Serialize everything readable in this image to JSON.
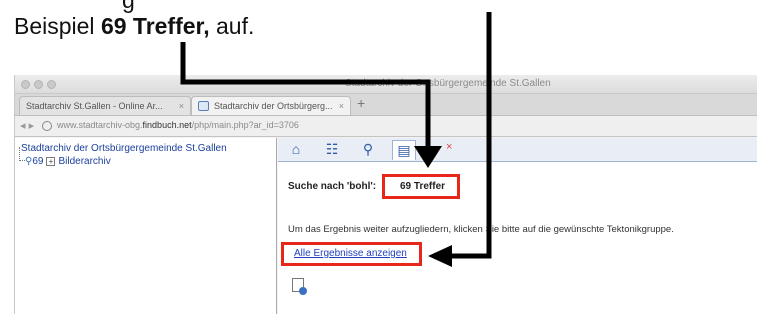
{
  "caption": {
    "line1_end": "g",
    "line2_prefix": "Beispiel ",
    "line2_bold": "69 Treffer,",
    "line2_suffix": " auf."
  },
  "window": {
    "title": "Stadtarchiv der Ortsbürgergemeinde St.Gallen",
    "tabs": [
      {
        "label": "Stadtarchiv St.Gallen - Online Ar...",
        "close": "×"
      },
      {
        "label": "Stadtarchiv der Ortsbürgerg...",
        "close": "×"
      }
    ],
    "new_tab": "+",
    "url_prefix": "www.stadtarchiv-obg.",
    "url_domain": "findbuch.net",
    "url_suffix": "/php/main.php?ar_id=3706"
  },
  "tree": {
    "root": "Stadtarchiv der Ortsbürgergemeinde St.Gallen",
    "count": "69",
    "plus": "+",
    "child": "Bilderarchiv"
  },
  "toolbar": {
    "home_icon": "⌂",
    "tree_icon": "☷",
    "search_icon": "⚲",
    "results_icon": "▤",
    "close_icon": "×"
  },
  "results": {
    "heading": "Suche nach 'bohl':",
    "hits": "69 Treffer",
    "hint": "Um das Ergebnis weiter aufzugliedern, klicken Sie bitte auf die gewünschte Tektonikgruppe.",
    "show_all": "Alle Ergebnisse anzeigen"
  },
  "colors": {
    "highlight": "#e8271b",
    "link": "#1f3fbd",
    "tree_text": "#1a3f9a"
  }
}
